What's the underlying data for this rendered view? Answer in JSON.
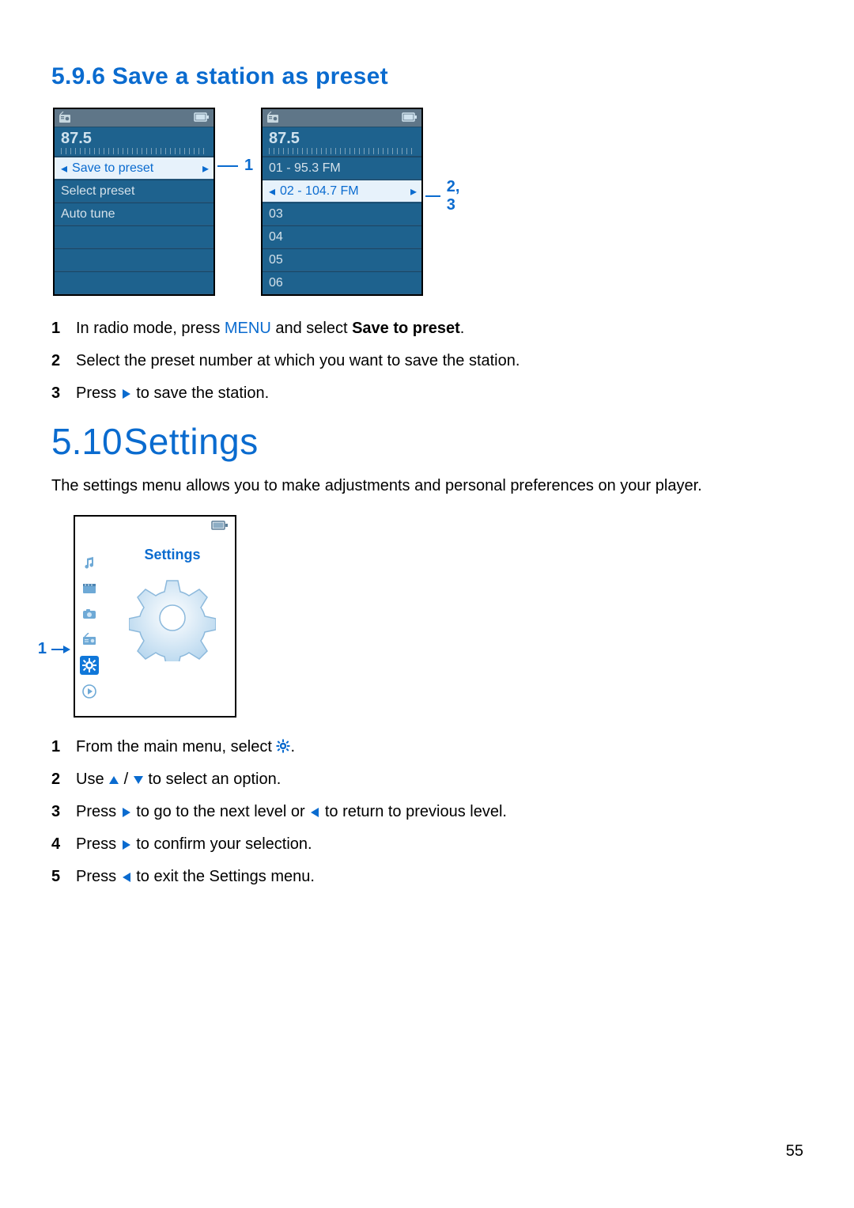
{
  "section596": {
    "heading": "5.9.6 Save a station as preset",
    "freq": "87.5",
    "screen1": {
      "rows": [
        "Save to preset",
        "Select preset",
        "Auto tune"
      ],
      "selected": 0,
      "callout": "1"
    },
    "screen2": {
      "rows": [
        "01 - 95.3 FM",
        "02 - 104.7 FM",
        "03",
        "04",
        "05",
        "06"
      ],
      "selected": 1,
      "callout": "2, 3"
    },
    "steps": [
      {
        "n": "1",
        "pre": "In radio mode, press ",
        "menu": "MENU",
        "post": " and select ",
        "bold": "Save to preset",
        "tail": "."
      },
      {
        "n": "2",
        "text": "Select the preset number at which you want to save the station."
      },
      {
        "n": "3",
        "pre": "Press ",
        "icon": "play-right",
        "post": " to save the station."
      }
    ]
  },
  "section510": {
    "heading_num": "5.10",
    "heading_txt": "Settings",
    "para": "The settings menu allows you to make adjustments and personal preferences on your player.",
    "screen": {
      "title": "Settings",
      "callout": "1"
    },
    "steps": [
      {
        "n": "1",
        "pre": "From the main menu, select ",
        "icon": "gear",
        "post": "."
      },
      {
        "n": "2",
        "pre": "Use ",
        "icon": "tri-up",
        "mid": " / ",
        "icon2": "tri-down",
        "post": " to select an option."
      },
      {
        "n": "3",
        "pre": "Press ",
        "icon": "play-right",
        "mid": " to go to the next level or ",
        "icon2": "play-left",
        "post": " to return to previous level."
      },
      {
        "n": "4",
        "pre": "Press ",
        "icon": "play-right",
        "post": " to confirm your selection."
      },
      {
        "n": "5",
        "pre": "Press ",
        "icon": "play-left",
        "post": " to exit the Settings menu."
      }
    ]
  },
  "page_number": "55"
}
